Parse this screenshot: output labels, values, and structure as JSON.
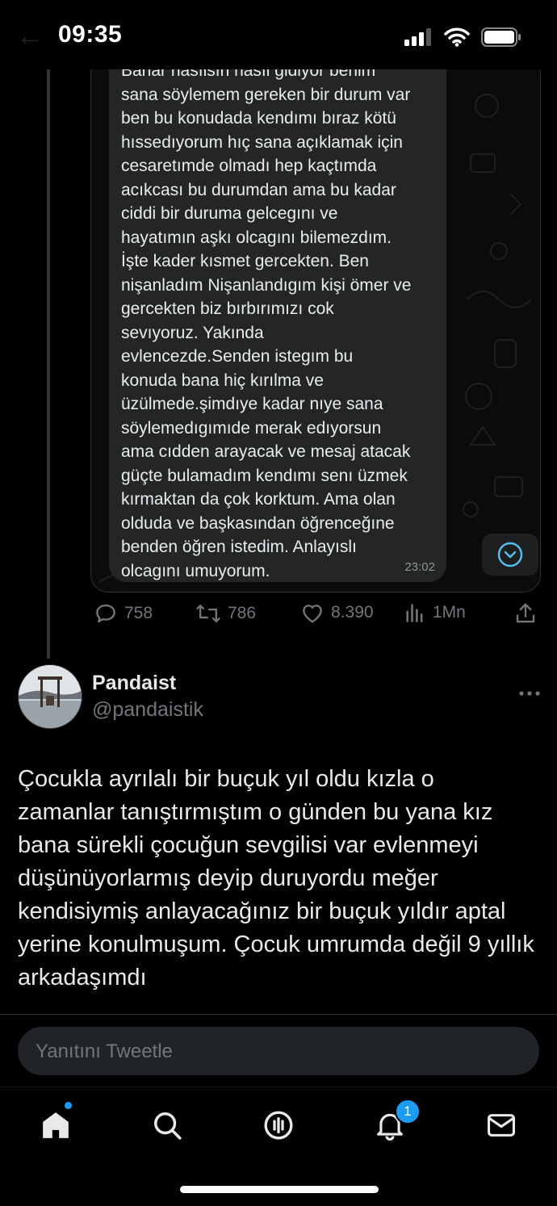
{
  "status_bar": {
    "time": "09:35"
  },
  "chat_message": {
    "text": "Banar nasılsın nasıl gidiyor benim\nsana söylemem gereken bir durum var\nben bu konudada kendımı bıraz kötü\nhıssedıyorum hıç sana açıklamak için\ncesaretımde olmadı hep kaçtımda\nacıkcası bu durumdan ama bu kadar\nciddi bir duruma gelcegını ve\nhayatımın aşkı olcagını bilemezdım.\nİşte kader kısmet gercekten. Ben\nnişanladım Nişanlandıgım kişi ömer ve\ngercekten biz bırbırımızı cok\nsevıyoruz. Yakında\nevlencezde.Senden istegım bu\nkonuda bana hiç kırılma ve\nüzülmede.şimdıye kadar nıye sana\nsöylemedıgımıde merak edıyorsun\nama cıdden arayacak ve mesaj atacak\ngüçte bulamadım kendımı senı üzmek\nkırmaktan da çok korktum. Ama olan\nolduda ve başkasından öğrenceğıne\nbenden öğren istedim. Anlayıslı\nolcagını umuyorum.",
    "time": "23:02"
  },
  "tweet_stats": {
    "replies": "758",
    "retweets": "786",
    "likes": "8.390",
    "views": "1Mn"
  },
  "reply_tweet": {
    "author_name": "Pandaist",
    "author_handle": "@pandaistik",
    "text": "Çocukla ayrılalı bir buçuk yıl oldu kızla o zamanlar tanıştırmıştım o günden bu yana kız bana sürekli çocuğun sevgilisi var evlenmeyi düşünüyorlarmış deyip duruyordu meğer kendisiymiş anlayacağınız bir buçuk yıldır aptal yerine konulmuşum. Çocuk umrumda değil 9 yıllık arkadaşımdı"
  },
  "reply_box": {
    "placeholder": "Yanıtını Tweetle"
  },
  "bottom_nav": {
    "items": [
      "home-icon",
      "search-icon",
      "spaces-icon",
      "notifications-icon",
      "messages-icon"
    ],
    "notifications_badge": "1"
  },
  "colors": {
    "accent": "#1d9bf0",
    "background": "#000000",
    "muted": "#71767b",
    "bubble": "#242626"
  }
}
